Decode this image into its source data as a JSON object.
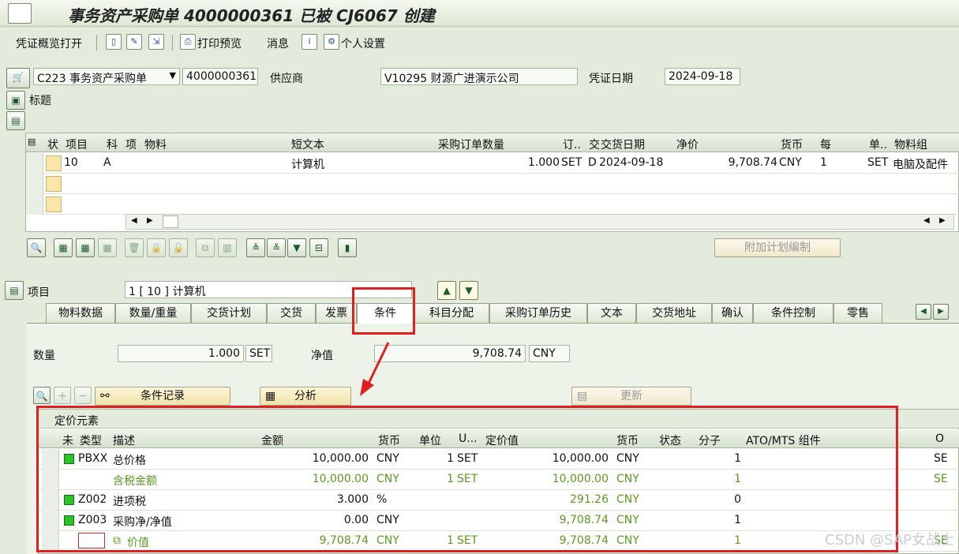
{
  "window": {
    "title": "事务资产采购单 4000000361 已被 CJ6067 创建"
  },
  "toolbar": {
    "doc_overview": "凭证概览打开",
    "print_preview": "打印预览",
    "messages": "消息",
    "personal_settings": "个人设置"
  },
  "header": {
    "doc_type_value": "C223 事务资产采购单",
    "po_number": "4000000361",
    "vendor_label": "供应商",
    "vendor_value": "V10295 财源广进演示公司",
    "doc_date_label": "凭证日期",
    "doc_date_value": "2024-09-18",
    "title_section": "标题"
  },
  "items_table": {
    "columns": [
      "状",
      "项目",
      "科",
      "项",
      "物料",
      "短文本",
      "采购订单数量",
      "订..",
      "交",
      "交货日期",
      "净价",
      "货币",
      "每",
      "单..",
      "物料组"
    ],
    "rows": [
      {
        "item": "10",
        "acct": "A",
        "short_text": "计算机",
        "qty": "1.000",
        "unit": "SET",
        "d": "D",
        "date": "2024-09-18",
        "price": "9,708.74",
        "currency": "CNY",
        "per": "1",
        "unit2": "SET",
        "matgroup": "电脑及配件"
      }
    ]
  },
  "item_toolbar": {
    "schedule_btn": "附加计划编制"
  },
  "item_detail": {
    "label": "项目",
    "select_value": "1 [ 10 ] 计算机"
  },
  "tabs": [
    "物料数据",
    "数量/重量",
    "交货计划",
    "交货",
    "发票",
    "条件",
    "科目分配",
    "采购订单历史",
    "文本",
    "交货地址",
    "确认",
    "条件控制",
    "零售"
  ],
  "active_tab": "条件",
  "conditions": {
    "qty_label": "数量",
    "qty_value": "1.000",
    "qty_unit": "SET",
    "net_label": "净值",
    "net_value": "9,708.74",
    "net_currency": "CNY",
    "cond_record_btn": "条件记录",
    "analysis_btn": "分析",
    "update_btn": "更新",
    "pricing_title": "定价元素",
    "columns": [
      "未",
      "类型",
      "描述",
      "金额",
      "货币",
      "单位",
      "U...",
      "定价值",
      "货币",
      "状态",
      "分子",
      "ATO/MTS 组件",
      "O"
    ],
    "rows": [
      {
        "status": true,
        "type": "PBXX",
        "desc": "总价格",
        "amount": "10,000.00",
        "curr": "CNY",
        "per": "1",
        "uom": "SET",
        "value": "10,000.00",
        "vcurr": "CNY",
        "num": "1",
        "o": "SE",
        "subtotal": false
      },
      {
        "status": false,
        "type": "",
        "desc": "含税金额",
        "amount": "10,000.00",
        "curr": "CNY",
        "per": "1",
        "uom": "SET",
        "value": "10,000.00",
        "vcurr": "CNY",
        "num": "1",
        "o": "SE",
        "subtotal": true
      },
      {
        "status": true,
        "type": "Z002",
        "desc": "进项税",
        "amount": "3.000",
        "curr": "%",
        "per": "",
        "uom": "",
        "value": "291.26",
        "vcurr": "CNY",
        "num": "0",
        "o": "",
        "subtotal": false
      },
      {
        "status": true,
        "type": "Z003",
        "desc": "采购净/净值",
        "amount": "0.00",
        "curr": "CNY",
        "per": "",
        "uom": "",
        "value": "9,708.74",
        "vcurr": "CNY",
        "num": "1",
        "o": "",
        "subtotal": false
      },
      {
        "status": false,
        "type": "",
        "desc": "价值",
        "amount": "9,708.74",
        "curr": "CNY",
        "per": "1",
        "uom": "SET",
        "value": "9,708.74",
        "vcurr": "CNY",
        "num": "1",
        "o": "SE",
        "subtotal": true
      }
    ]
  },
  "watermark": "CSDN @SAP女战士",
  "colors": {
    "highlight": "#e02020",
    "subtotal_text": "#5a9a1e",
    "status_green": "#28c428"
  }
}
